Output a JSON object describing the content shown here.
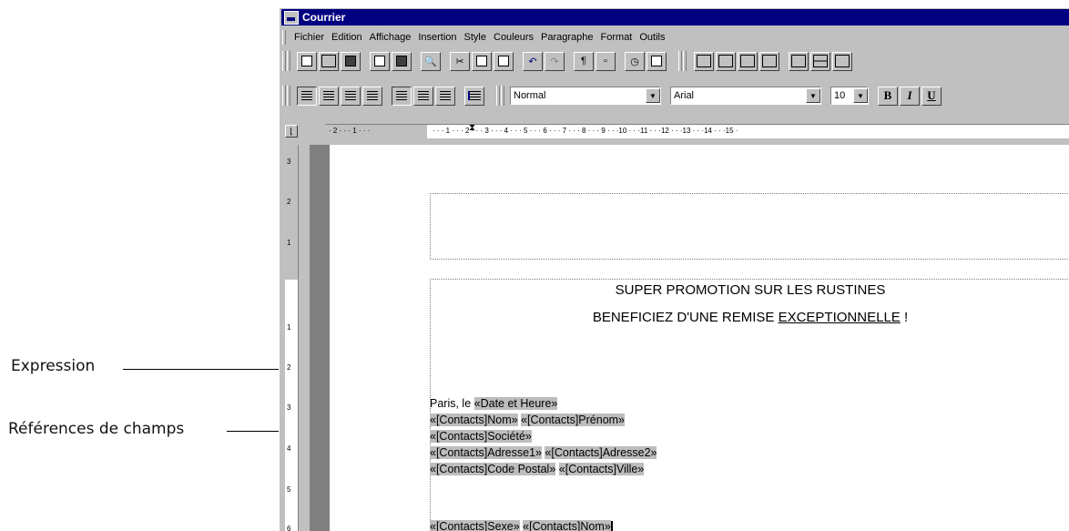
{
  "annotations": {
    "expression": "Expression",
    "field_refs": "Références de champs"
  },
  "window": {
    "title": "Courrier"
  },
  "menu": [
    "Fichier",
    "Edition",
    "Affichage",
    "Insertion",
    "Style",
    "Couleurs",
    "Paragraphe",
    "Format",
    "Outils"
  ],
  "format_bar": {
    "style_value": "Normal",
    "font_value": "Arial",
    "size_value": "10",
    "bold_label": "B",
    "italic_label": "I",
    "underline_label": "U"
  },
  "ruler": {
    "left_ticks": "· 2 · · · 1 · · ·",
    "ticks": "· · · 1 · · · 2 · · · 3 · · · 4 · · · 5 · · · 6 · · · 7 · · · 8 · · · 9 · · ·10 · · ·11 · · ·12 · · ·13 · · ·14 · · ·15 ·",
    "vertical_numbers": [
      "3",
      "2",
      "1",
      "1",
      "2",
      "3",
      "4",
      "5",
      "6"
    ]
  },
  "document": {
    "heading1": "SUPER PROMOTION SUR LES RUSTINES",
    "heading2_prefix": "BENEFICIEZ D'UNE REMISE ",
    "heading2_underlined": "EXCEPTIONNELLE",
    "heading2_suffix": " !",
    "date_prefix": "Paris, le ",
    "date_field": "«Date et Heure»",
    "nom_field": "«[Contacts]Nom»",
    "prenom_field": "«[Contacts]Prénom»",
    "societe_field": "«[Contacts]Société»",
    "adresse1_field": "«[Contacts]Adresse1»",
    "adresse2_field": "«[Contacts]Adresse2»",
    "cp_field": "«[Contacts]Code Postal»",
    "ville_field": "«[Contacts]Ville»",
    "sexe_field": "«[Contacts]Sexe»",
    "nom2_field": "«[Contacts]Nom»"
  }
}
